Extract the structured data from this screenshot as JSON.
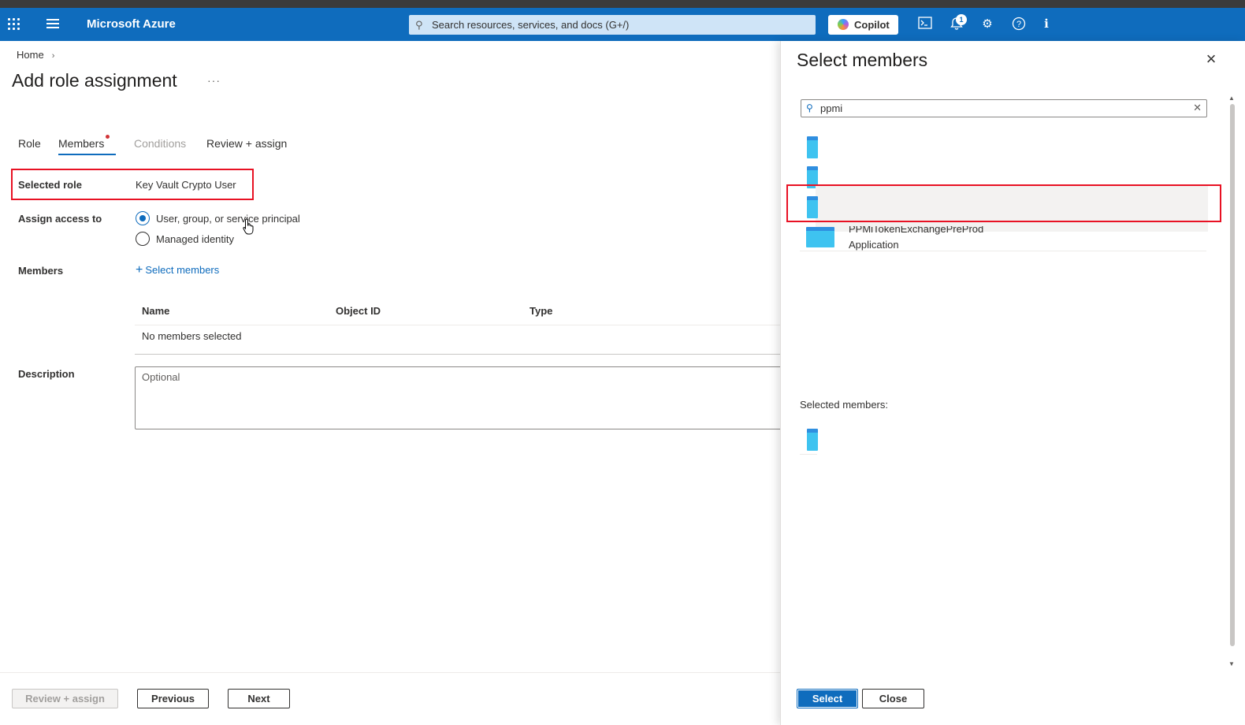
{
  "header": {
    "brand": "Microsoft Azure",
    "search_placeholder": "Search resources, services, and docs (G+/)",
    "copilot_label": "Copilot",
    "notification_count": "1",
    "accent_color": "#0f6cbd"
  },
  "breadcrumb": {
    "home": "Home"
  },
  "page": {
    "title": "Add role assignment",
    "more": "···"
  },
  "tabs": [
    {
      "label": "Role"
    },
    {
      "label": "Members"
    },
    {
      "label": "Conditions"
    },
    {
      "label": "Review + assign"
    }
  ],
  "form": {
    "selected_role_label": "Selected role",
    "selected_role_value": "Key Vault Crypto User",
    "assign_access_label": "Assign access to",
    "option_user": "User, group, or service principal",
    "option_managed": "Managed identity",
    "members_label": "Members",
    "select_members_link": "Select members",
    "table_headers": {
      "name": "Name",
      "object_id": "Object ID",
      "type": "Type"
    },
    "no_members": "No members selected",
    "description_label": "Description",
    "description_placeholder": "Optional"
  },
  "footer": {
    "review_assign": "Review + assign",
    "previous": "Previous",
    "next": "Next"
  },
  "panel": {
    "title": "Select members",
    "search_value": "ppmi",
    "results": [
      {
        "name": "",
        "type": ""
      },
      {
        "name": "",
        "type": ""
      },
      {
        "name": "",
        "type": ""
      },
      {
        "name": "PPMiTokenExchangePreProd",
        "type": "Application"
      }
    ],
    "selected_members_label": "Selected members:",
    "select_button": "Select",
    "close_button": "Close"
  }
}
